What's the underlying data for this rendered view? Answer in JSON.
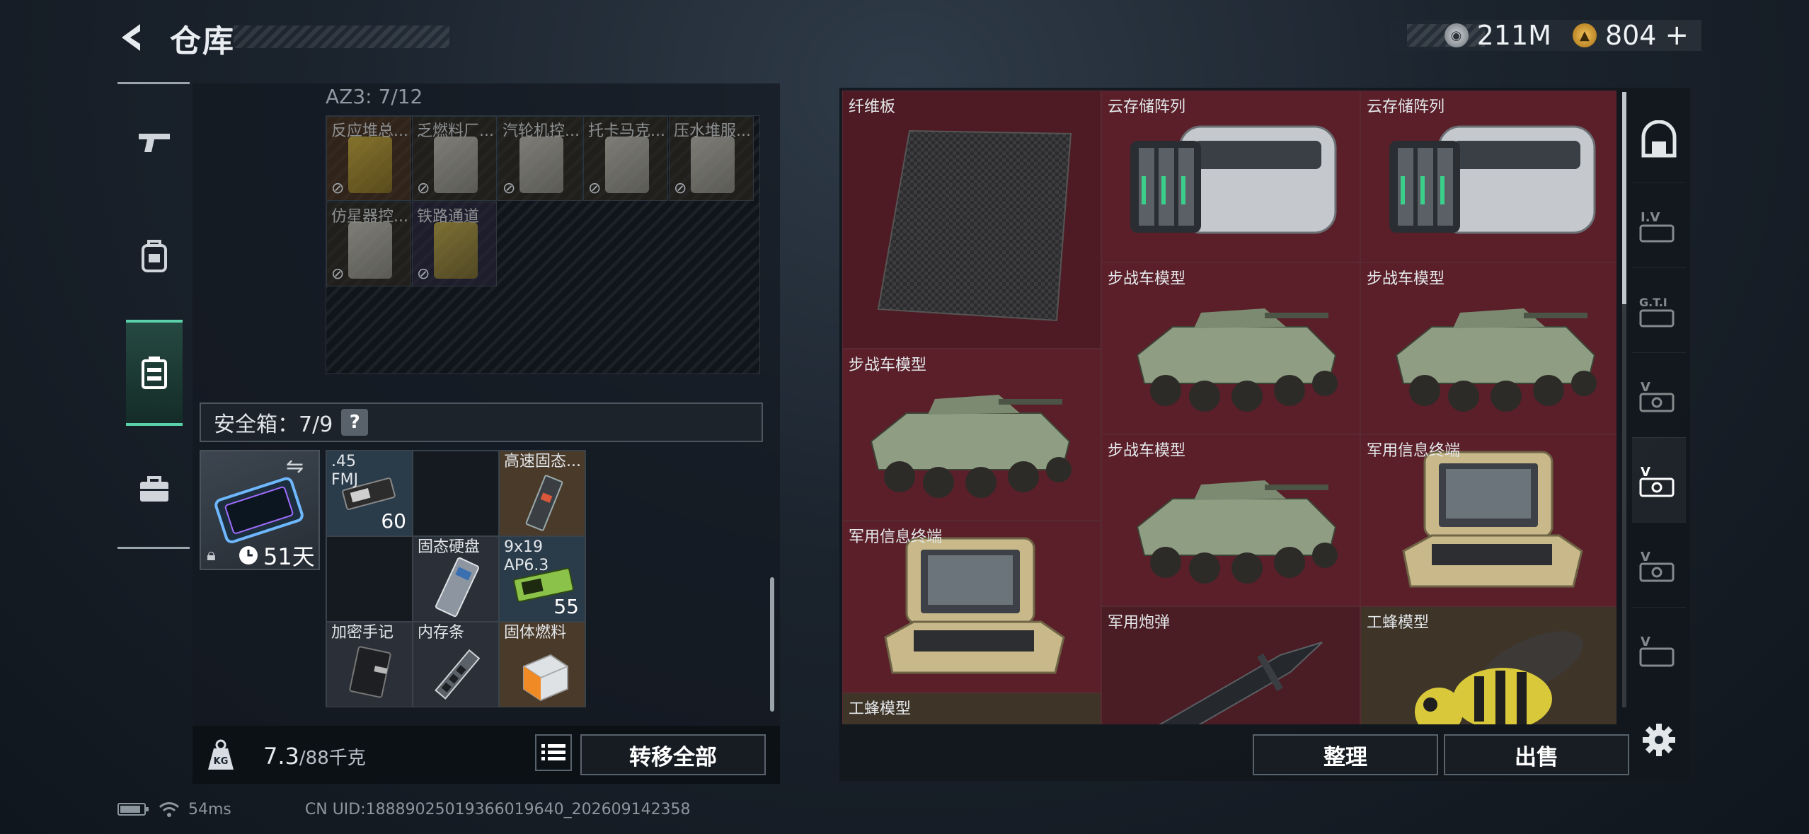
{
  "topbar": {
    "title": "仓库",
    "currency_silver": "211M",
    "currency_gold": "804",
    "gold_plus": "+",
    "accent_color": "#5ad1a8"
  },
  "leftnav": {
    "items": [
      {
        "icon": "pistol-icon"
      },
      {
        "icon": "backpack-icon"
      },
      {
        "icon": "safebox-icon",
        "active": true
      },
      {
        "icon": "briefcase-icon"
      }
    ]
  },
  "az3": {
    "label": "AZ3: 7/12",
    "items": [
      {
        "name": "反应堆总..."
      },
      {
        "name": "乏燃料厂..."
      },
      {
        "name": "汽轮机控..."
      },
      {
        "name": "托卡马克..."
      },
      {
        "name": "压水堆服..."
      },
      {
        "name": "仿星器控..."
      },
      {
        "name": "铁路通道"
      }
    ]
  },
  "safebox": {
    "label": "安全箱：7/9",
    "help": "?",
    "days": "51天",
    "items": [
      {
        "name": ".45 FMJ",
        "qty": "60"
      },
      {
        "name": "",
        "qty": ""
      },
      {
        "name": "高速固态...",
        "qty": ""
      },
      {
        "name": "",
        "qty": ""
      },
      {
        "name": "固态硬盘",
        "qty": ""
      },
      {
        "name": "9x19 AP6.3",
        "qty": "55"
      },
      {
        "name": "加密手记",
        "qty": ""
      },
      {
        "name": "内存条",
        "qty": ""
      },
      {
        "name": "固体燃料",
        "qty": ""
      }
    ]
  },
  "weight": {
    "current": "7.3",
    "max": "/88千克",
    "transfer_label": "转移全部"
  },
  "stash": {
    "items": [
      {
        "name": "纤维板"
      },
      {
        "name": "云存储阵列"
      },
      {
        "name": "云存储阵列"
      },
      {
        "name": "步战车模型"
      },
      {
        "name": "步战车模型"
      },
      {
        "name": "步战车模型"
      },
      {
        "name": "步战车模型"
      },
      {
        "name": "军用信息终端"
      },
      {
        "name": "军用信息终端"
      },
      {
        "name": "军用炮弹"
      },
      {
        "name": "工蜂模型"
      },
      {
        "name": "工蜂模型"
      }
    ],
    "sort_label": "整理",
    "sell_label": "出售"
  },
  "right_tabs": [
    {
      "icon": "safe-door-icon"
    },
    {
      "icon": "tab-iv-icon"
    },
    {
      "icon": "tab-gti-icon"
    },
    {
      "icon": "tab-v-icon"
    },
    {
      "icon": "tab-v-icon",
      "active": true
    },
    {
      "icon": "tab-v-icon"
    },
    {
      "icon": "tab-v-icon"
    }
  ],
  "footer": {
    "ping": "54ms",
    "uid": "CN UID:1888902501936601964​0_202609142358"
  }
}
